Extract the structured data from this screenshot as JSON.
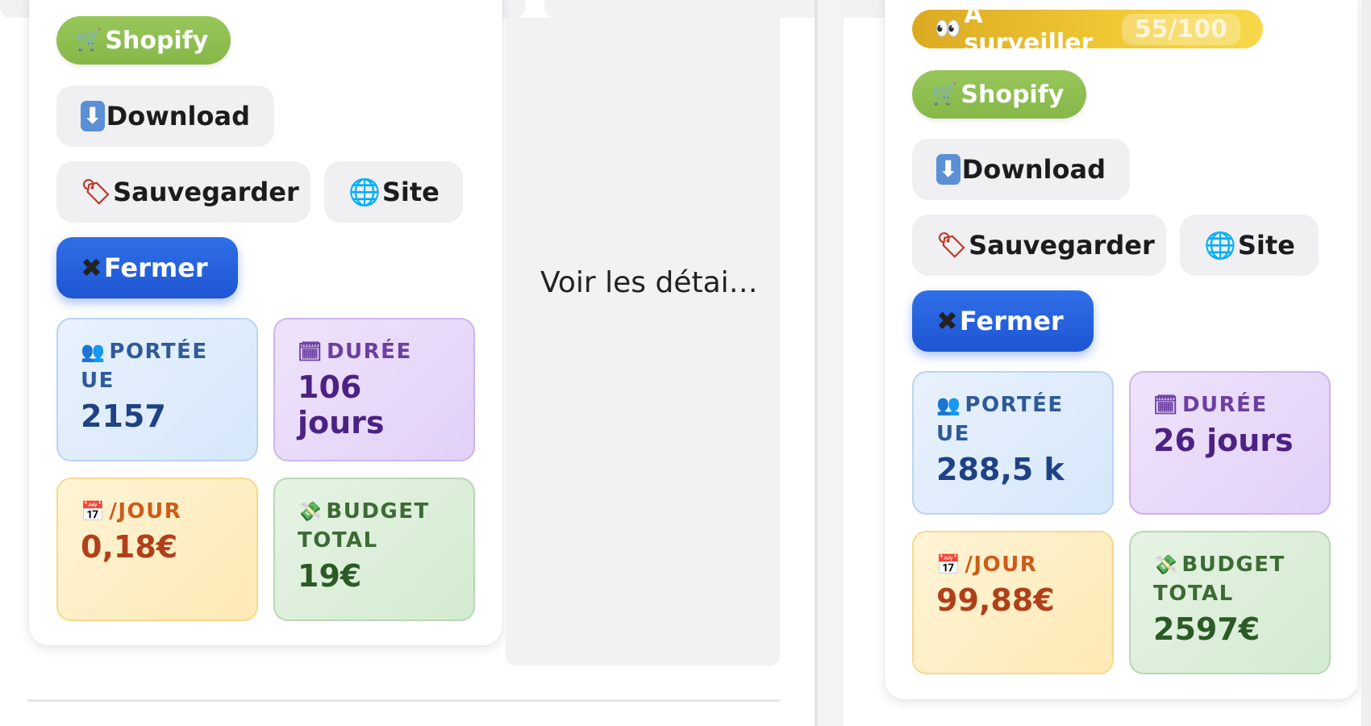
{
  "left_card": {
    "platform": "Shopify",
    "buttons": {
      "download": "Download",
      "save": "Sauvegarder",
      "site": "Site",
      "close": "Fermer"
    },
    "stats": {
      "reach_label": "PORTÉE UE",
      "reach_value": "2157",
      "duration_label": "DURÉE",
      "duration_value": "106 jours",
      "per_day_label": "/JOUR",
      "per_day_value": "0,18€",
      "budget_label": "BUDGET TOTAL",
      "budget_value": "19€"
    }
  },
  "side_panel": {
    "text": "Voir les détai…"
  },
  "right_card": {
    "watch_label": "À surveiller",
    "score": "55/100",
    "platform": "Shopify",
    "buttons": {
      "download": "Download",
      "save": "Sauvegarder",
      "site": "Site",
      "close": "Fermer"
    },
    "stats": {
      "reach_label": "PORTÉE UE",
      "reach_value": "288,5 k",
      "duration_label": "DURÉE",
      "duration_value": "26 jours",
      "per_day_label": "/JOUR",
      "per_day_value": "99,88€",
      "budget_label": "BUDGET TOTAL",
      "budget_value": "2597€"
    }
  },
  "colors": {
    "shopify_green": "#8fbf4f",
    "primary_blue": "#2563eb",
    "watch_yellow": "#f0c83a"
  },
  "icons": [
    "cart-icon",
    "download-icon",
    "tag-icon",
    "globe-icon",
    "close-icon",
    "people-icon",
    "calendar-icon",
    "money-icon",
    "eyes-icon"
  ]
}
